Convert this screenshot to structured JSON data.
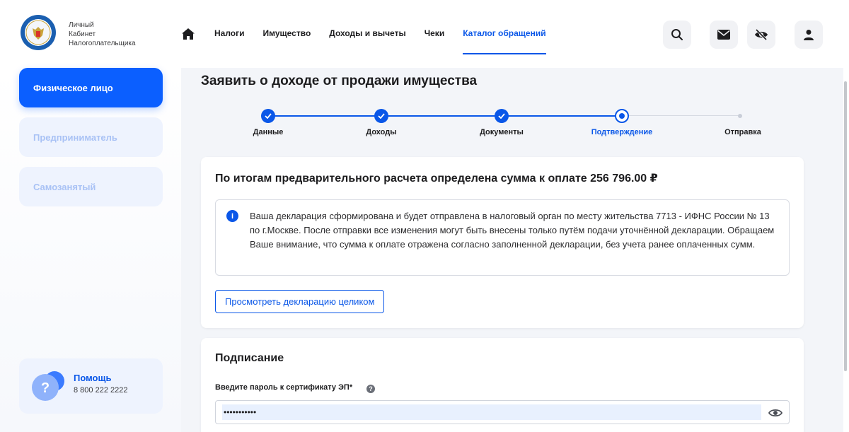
{
  "header": {
    "logo_lines": [
      "Личный",
      "Кабинет",
      "Налогоплательщика"
    ],
    "nav": [
      {
        "label": "Налоги",
        "active": false
      },
      {
        "label": "Имущество",
        "active": false
      },
      {
        "label": "Доходы и вычеты",
        "active": false
      },
      {
        "label": "Чеки",
        "active": false
      },
      {
        "label": "Каталог обращений",
        "active": true
      }
    ],
    "icons": [
      "home-icon",
      "search-icon",
      "mail-icon",
      "eye-off-icon",
      "user-icon"
    ]
  },
  "sidebar": {
    "items": [
      {
        "label": "Физическое лицо",
        "active": true
      },
      {
        "label": "Предприниматель",
        "active": false
      },
      {
        "label": "Самозанятый",
        "active": false
      }
    ],
    "help": {
      "title": "Помощь",
      "phone": "8 800 222 2222"
    }
  },
  "main": {
    "title": "Заявить о доходе от продажи имущества",
    "steps": [
      {
        "label": "Данные",
        "state": "done"
      },
      {
        "label": "Доходы",
        "state": "done"
      },
      {
        "label": "Документы",
        "state": "done"
      },
      {
        "label": "Подтверждение",
        "state": "current"
      },
      {
        "label": "Отправка",
        "state": "pending"
      }
    ],
    "summary": {
      "heading": "По итогам предварительного расчета определена сумма к оплате 256 796.00 ₽",
      "info_text": "Ваша декларация сформирована и будет отправлена в налоговый орган по месту жительства 7713 - ИФНС России № 13 по г.Москве. После отправки все изменения могут быть внесены только путём подачи уточнённой декларации. Обращаем Ваше внимание, что сумма к оплате отражена согласно заполненной декларации, без учета ранее оплаченных сумм.",
      "view_button": "Просмотреть декларацию целиком"
    },
    "signing": {
      "heading": "Подписание",
      "password_label": "Введите пароль к сертификату ЭП*",
      "password_value": "•••••••••••"
    }
  },
  "colors": {
    "accent": "#0a57e8",
    "sidebar_active": "#0b5fff",
    "sidebar_inactive_bg": "#eef3fe",
    "main_bg": "#f3f5f9"
  }
}
